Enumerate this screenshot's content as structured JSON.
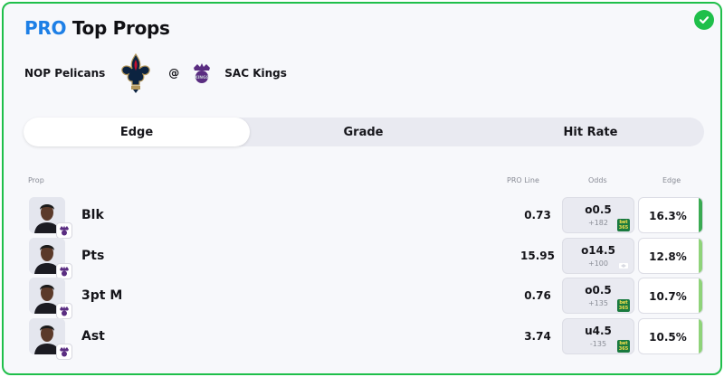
{
  "header": {
    "title_pro": "PRO",
    "title_rest": "Top Props"
  },
  "matchup": {
    "away_team": "NOP Pelicans",
    "separator": "@",
    "home_team": "SAC Kings",
    "home_logo_text": "KINGS"
  },
  "tabs": [
    {
      "label": "Edge",
      "active": true
    },
    {
      "label": "Grade",
      "active": false
    },
    {
      "label": "Hit Rate",
      "active": false
    }
  ],
  "columns": {
    "prop": "Prop",
    "pro_line": "PRO Line",
    "odds": "Odds",
    "edge": "Edge"
  },
  "rows": [
    {
      "prop": "Blk",
      "pro_line": "0.73",
      "odds_line": "o0.5",
      "odds_price": "+182",
      "edge": "16.3%",
      "edge_color": "#3aaa52"
    },
    {
      "prop": "Pts",
      "pro_line": "15.95",
      "odds_line": "o14.5",
      "odds_price": "+100",
      "edge": "12.8%",
      "edge_color": "#8fd37a"
    },
    {
      "prop": "3pt M",
      "pro_line": "0.76",
      "odds_line": "o0.5",
      "odds_price": "+135",
      "edge": "10.7%",
      "edge_color": "#8fd37a"
    },
    {
      "prop": "Ast",
      "pro_line": "3.74",
      "odds_line": "u4.5",
      "odds_price": "-135",
      "edge": "10.5%",
      "edge_color": "#8fd37a"
    }
  ],
  "bookmaker": {
    "line1": "bet",
    "line2": "365"
  },
  "colors": {
    "accent": "#1d7fe6",
    "border": "#1fbf4a"
  }
}
